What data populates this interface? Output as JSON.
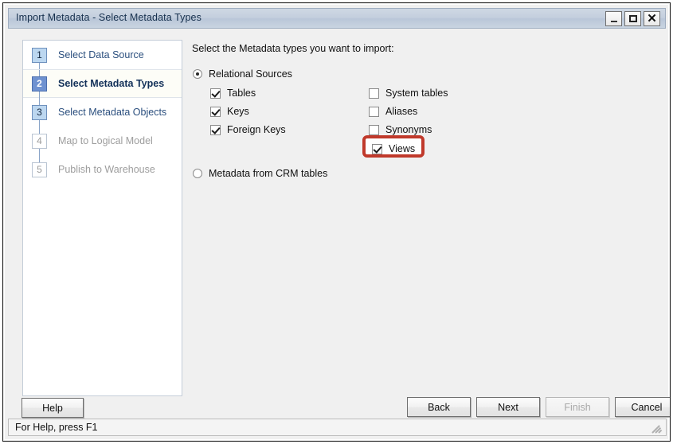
{
  "window": {
    "title": "Import Metadata - Select Metadata Types",
    "minimize_label": "_",
    "maximize_label": "▢",
    "close_label": "✕"
  },
  "sidebar": {
    "steps": [
      {
        "num": "1",
        "label": "Select Data Source",
        "state": "done"
      },
      {
        "num": "2",
        "label": "Select Metadata Types",
        "state": "current"
      },
      {
        "num": "3",
        "label": "Select Metadata Objects",
        "state": "done"
      },
      {
        "num": "4",
        "label": "Map to Logical Model",
        "state": "todo"
      },
      {
        "num": "5",
        "label": "Publish to Warehouse",
        "state": "todo"
      }
    ]
  },
  "main": {
    "prompt": "Select the Metadata types you want to import:",
    "radios": [
      {
        "label": "Relational Sources",
        "checked": true
      },
      {
        "label": "Metadata from CRM tables",
        "checked": false
      }
    ],
    "checkboxes_left": [
      {
        "label": "Tables",
        "checked": true
      },
      {
        "label": "Keys",
        "checked": true
      },
      {
        "label": "Foreign Keys",
        "checked": true
      }
    ],
    "checkboxes_right": [
      {
        "label": "System tables",
        "checked": false
      },
      {
        "label": "Aliases",
        "checked": false
      },
      {
        "label": "Synonyms",
        "checked": false
      },
      {
        "label": "Views",
        "checked": true
      }
    ],
    "highlight_color": "#c0392b",
    "highlight_target": "Views"
  },
  "buttons": {
    "help": {
      "label": "Help",
      "disabled": false
    },
    "back": {
      "label": "Back",
      "disabled": false
    },
    "next": {
      "label": "Next",
      "disabled": false
    },
    "finish": {
      "label": "Finish",
      "disabled": true
    },
    "cancel": {
      "label": "Cancel",
      "disabled": false
    }
  },
  "statusbar": {
    "text": "For Help, press F1"
  }
}
